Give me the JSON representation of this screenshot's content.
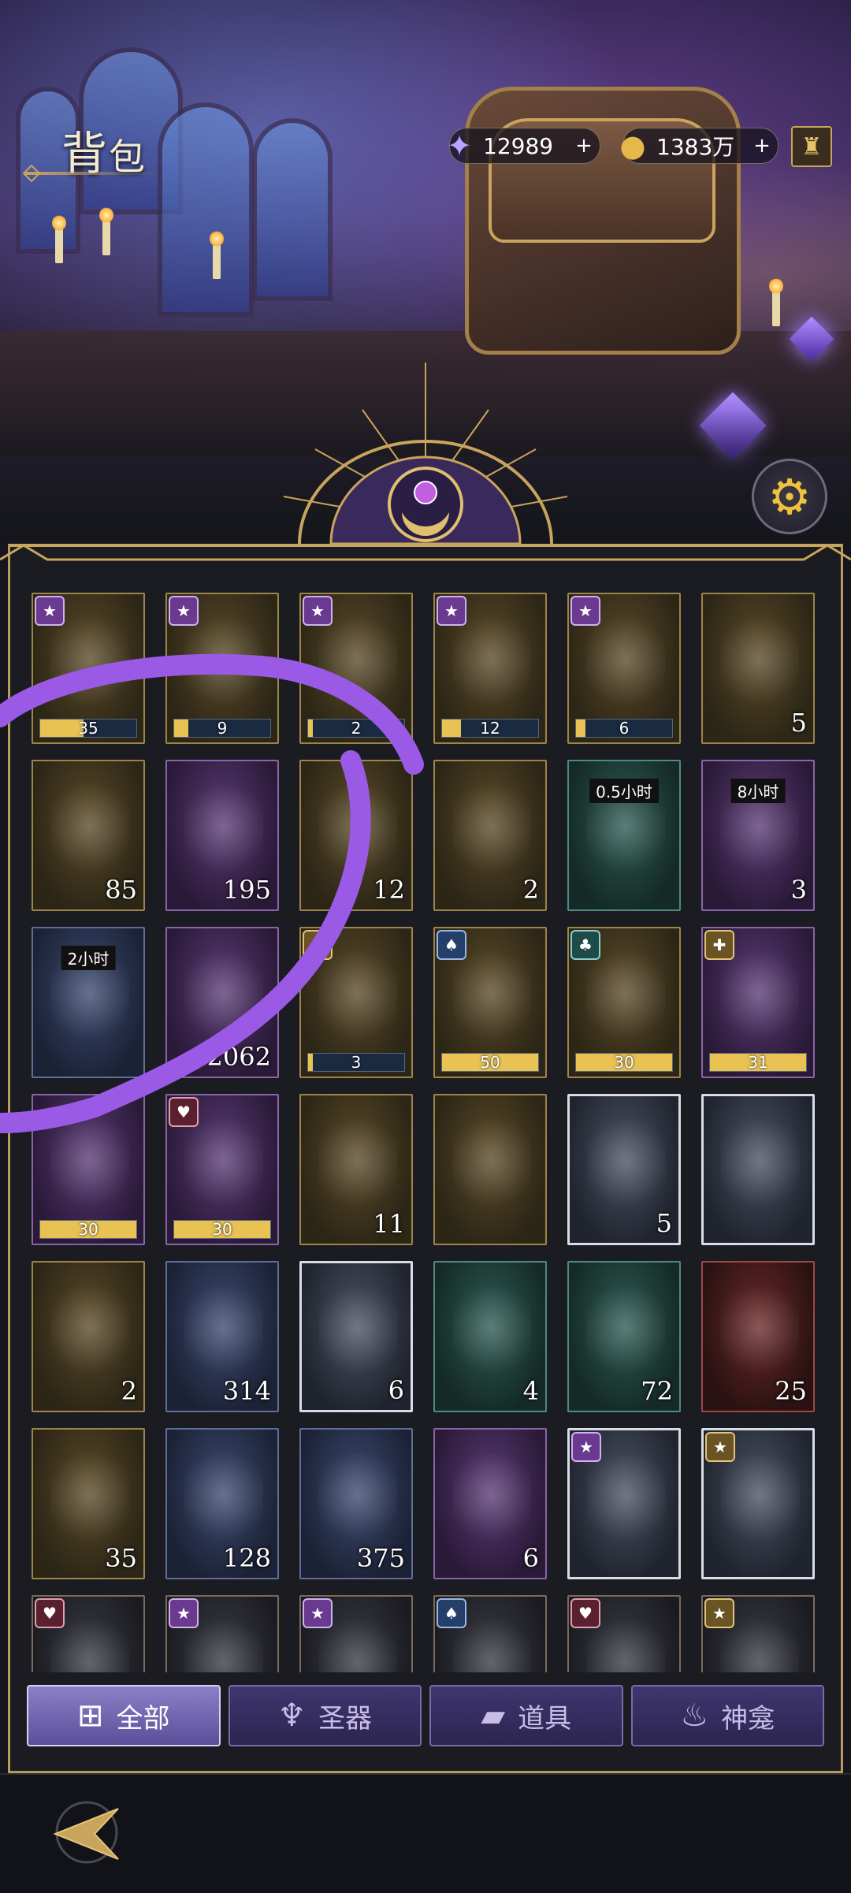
{
  "header": {
    "title_a": "背",
    "title_b": "包",
    "currencies": [
      {
        "icon": "star-crystal-icon",
        "value": "12989"
      },
      {
        "icon": "gold-coin-icon",
        "value": "1383万"
      }
    ],
    "plus": "+",
    "bag_icon": "money-bag-icon",
    "settings_icon": "gear-icon"
  },
  "items": [
    {
      "name": "character-fragment",
      "frame": "gold",
      "badge": "purple",
      "badge_icon": "star",
      "bar": {
        "label": "35",
        "fraction": 0.45
      }
    },
    {
      "name": "character-fragment",
      "frame": "gold",
      "badge": "purple",
      "badge_icon": "star",
      "bar": {
        "label": "9",
        "fraction": 0.15
      }
    },
    {
      "name": "character-fragment",
      "frame": "gold",
      "badge": "purple",
      "badge_icon": "star",
      "bar": {
        "label": "2",
        "fraction": 0.05
      }
    },
    {
      "name": "character-fragment",
      "frame": "gold",
      "badge": "purple",
      "badge_icon": "star",
      "bar": {
        "label": "12",
        "fraction": 0.2
      }
    },
    {
      "name": "character-fragment",
      "frame": "gold",
      "badge": "purple",
      "badge_icon": "star",
      "bar": {
        "label": "6",
        "fraction": 0.1
      }
    },
    {
      "name": "golden-key",
      "frame": "gold",
      "count": "5"
    },
    {
      "name": "golden-feather",
      "frame": "gold",
      "count": "85"
    },
    {
      "name": "dark-feather",
      "frame": "purple",
      "count": "195"
    },
    {
      "name": "fireworks",
      "frame": "gold",
      "count": "12"
    },
    {
      "name": "potion-flask",
      "frame": "gold",
      "count": "2"
    },
    {
      "name": "treasure-chest",
      "frame": "teal",
      "timer": "0.5小时"
    },
    {
      "name": "exp-chest",
      "frame": "purple",
      "timer": "8小时",
      "count": "3"
    },
    {
      "name": "coin-pouch",
      "frame": "blue",
      "timer": "2小时"
    },
    {
      "name": "swap-token",
      "frame": "purple",
      "count": "2062"
    },
    {
      "name": "spade-crystal",
      "frame": "gold",
      "badge": "gold",
      "badge_icon": "cross",
      "bar": {
        "label": "3",
        "fraction": 0.05
      }
    },
    {
      "name": "spade-crystal",
      "frame": "gold",
      "badge": "blue",
      "badge_icon": "spade",
      "bar": {
        "label": "50",
        "fraction": 1.0
      }
    },
    {
      "name": "club-crystal",
      "frame": "gold",
      "badge": "teal",
      "badge_icon": "club",
      "bar": {
        "label": "30",
        "fraction": 1.0
      }
    },
    {
      "name": "purple-spade-crystal",
      "frame": "purple",
      "badge": "gold",
      "badge_icon": "cross",
      "bar": {
        "label": "31",
        "fraction": 1.0
      }
    },
    {
      "name": "purple-spade-crystal",
      "frame": "purple",
      "bar": {
        "label": "30",
        "fraction": 1.0
      }
    },
    {
      "name": "purple-heart-crystal",
      "frame": "purple",
      "badge": "red",
      "badge_icon": "heart",
      "bar": {
        "label": "30",
        "fraction": 1.0
      }
    },
    {
      "name": "yellow-refresh-crystal",
      "frame": "gold",
      "count": "11"
    },
    {
      "name": "heart-padlock",
      "frame": "gold"
    },
    {
      "name": "ice-hammer",
      "frame": "silver",
      "count": "5"
    },
    {
      "name": "star-emblem",
      "frame": "silver"
    },
    {
      "name": "red-triangle-gem",
      "frame": "gold",
      "count": "2"
    },
    {
      "name": "blue-drop-gem",
      "frame": "blue",
      "count": "314"
    },
    {
      "name": "red-crystal-cluster",
      "frame": "silver",
      "count": "6"
    },
    {
      "name": "red-crystal",
      "frame": "teal",
      "count": "4"
    },
    {
      "name": "ornate-scepter",
      "frame": "teal",
      "count": "72"
    },
    {
      "name": "red-potion",
      "frame": "red",
      "count": "25"
    },
    {
      "name": "orange-potion",
      "frame": "gold",
      "count": "35"
    },
    {
      "name": "purple-dust",
      "frame": "blue",
      "count": "128"
    },
    {
      "name": "lavender-dust",
      "frame": "blue",
      "count": "375"
    },
    {
      "name": "purple-orb",
      "frame": "purple",
      "count": "6"
    },
    {
      "name": "relic-shell",
      "frame": "silver",
      "badge": "purple",
      "badge_icon": "star"
    },
    {
      "name": "relic-shell",
      "frame": "silver",
      "badge": "gold",
      "badge_icon": "star"
    },
    {
      "name": "partial-item",
      "frame": "dark",
      "badge": "red",
      "badge_icon": "heart"
    },
    {
      "name": "partial-item",
      "frame": "dark",
      "badge": "purple",
      "badge_icon": "star"
    },
    {
      "name": "partial-item",
      "frame": "dark",
      "badge": "purple",
      "badge_icon": "star"
    },
    {
      "name": "partial-item",
      "frame": "dark",
      "badge": "blue",
      "badge_icon": "spade"
    },
    {
      "name": "partial-item",
      "frame": "dark",
      "badge": "red",
      "badge_icon": "heart"
    },
    {
      "name": "partial-item",
      "frame": "dark",
      "badge": "gold",
      "badge_icon": "star"
    }
  ],
  "tabs": [
    {
      "label": "全部",
      "icon": "grid-icon",
      "active": true
    },
    {
      "label": "圣器",
      "icon": "chalice-icon",
      "active": false
    },
    {
      "label": "道具",
      "icon": "ingot-icon",
      "active": false
    },
    {
      "label": "神龛",
      "icon": "shrine-icon",
      "active": false
    }
  ],
  "colors": {
    "accent_gold": "#c9a45c",
    "scribble": "#9a5ae6",
    "bar_fill": "#e8c253"
  },
  "back_icon": "back-arrow-icon"
}
